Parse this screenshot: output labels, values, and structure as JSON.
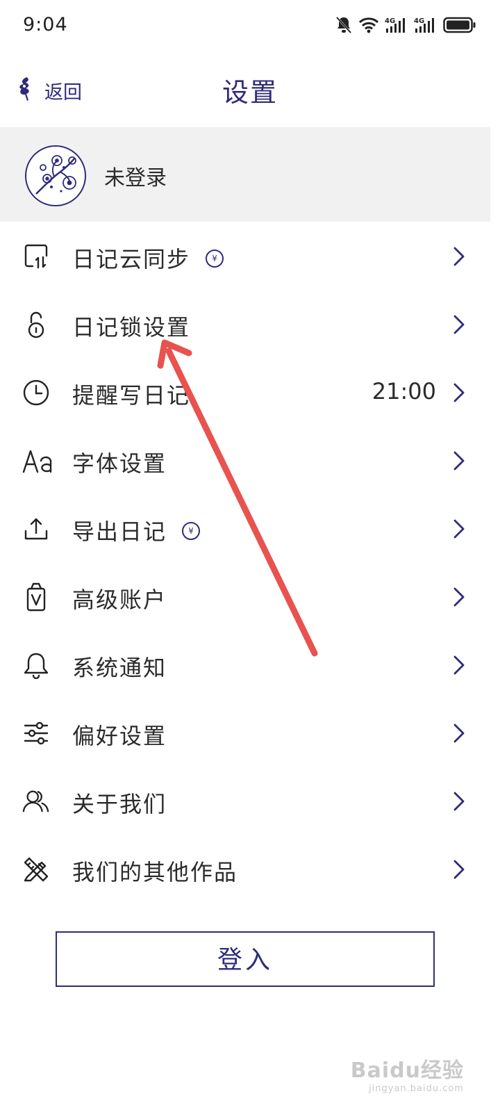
{
  "status_bar": {
    "time": "9:04",
    "icons": [
      "bell-off-icon",
      "wifi-icon",
      "signal-4g-icon",
      "signal-4g-icon",
      "battery-icon"
    ]
  },
  "header": {
    "back_label": "返回",
    "title": "设置"
  },
  "profile": {
    "name": "未登录"
  },
  "menu": {
    "items": [
      {
        "label": "日记云同步",
        "icon": "cloud-sync-icon",
        "badge": "¥",
        "value": ""
      },
      {
        "label": "日记锁设置",
        "icon": "lock-icon",
        "badge": "",
        "value": ""
      },
      {
        "label": "提醒写日记",
        "icon": "clock-icon",
        "badge": "",
        "value": "21:00"
      },
      {
        "label": "字体设置",
        "icon": "font-icon",
        "badge": "",
        "value": ""
      },
      {
        "label": "导出日记",
        "icon": "export-icon",
        "badge": "¥",
        "value": ""
      },
      {
        "label": "高级账户",
        "icon": "premium-icon",
        "badge": "",
        "value": ""
      },
      {
        "label": "系统通知",
        "icon": "bell-icon",
        "badge": "",
        "value": ""
      },
      {
        "label": "偏好设置",
        "icon": "sliders-icon",
        "badge": "",
        "value": ""
      },
      {
        "label": "关于我们",
        "icon": "users-icon",
        "badge": "",
        "value": ""
      },
      {
        "label": "我们的其他作品",
        "icon": "tools-icon",
        "badge": "",
        "value": ""
      }
    ]
  },
  "login_button": "登入",
  "watermark": {
    "main": "Baidu经验",
    "sub": "jingyan.baidu.com"
  },
  "colors": {
    "accent": "#2e2b7a",
    "profile_bg": "#f1f1f1",
    "annotation_arrow": "#e8524f"
  }
}
